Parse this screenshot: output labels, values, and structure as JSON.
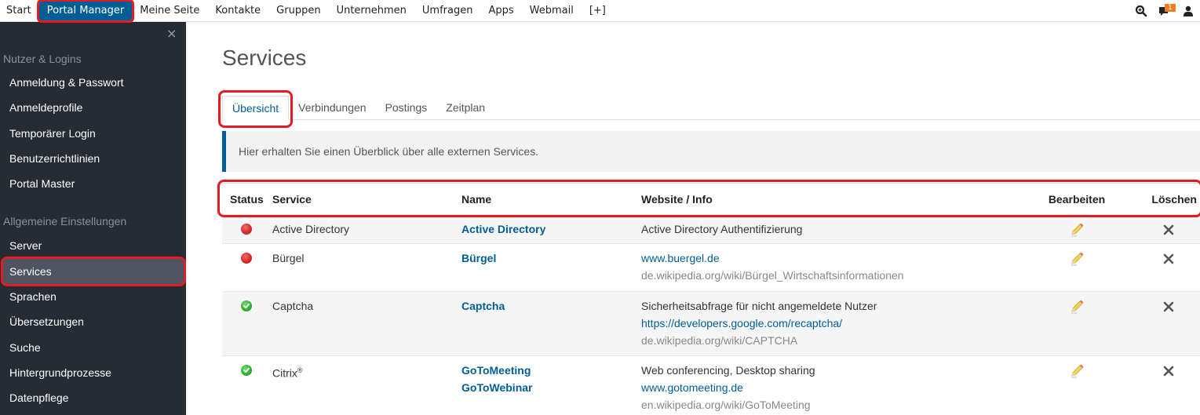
{
  "topnav": {
    "items": [
      {
        "label": "Start",
        "active": false
      },
      {
        "label": "Portal Manager",
        "active": true
      },
      {
        "label": "Meine Seite",
        "active": false
      },
      {
        "label": "Kontakte",
        "active": false
      },
      {
        "label": "Gruppen",
        "active": false
      },
      {
        "label": "Unternehmen",
        "active": false
      },
      {
        "label": "Umfragen",
        "active": false
      },
      {
        "label": "Apps",
        "active": false
      },
      {
        "label": "Webmail",
        "active": false
      },
      {
        "label": "[+]",
        "active": false
      }
    ],
    "icons": [
      "search-icon",
      "messages-icon",
      "user-icon"
    ],
    "messages_badge": "1"
  },
  "sidebar": {
    "close_icon": "×",
    "sections": [
      {
        "title": "Nutzer & Logins",
        "items": [
          "Anmeldung & Passwort",
          "Anmeldeprofile",
          "Temporärer Login",
          "Benutzerrichtlinien",
          "Portal Master"
        ]
      },
      {
        "title": "Allgemeine Einstellungen",
        "items": [
          "Server",
          "Services",
          "Sprachen",
          "Übersetzungen",
          "Suche",
          "Hintergrundprozesse",
          "Datenpflege"
        ]
      }
    ],
    "active_item": "Services"
  },
  "main": {
    "title": "Services",
    "tabs": [
      {
        "label": "Übersicht",
        "active": true
      },
      {
        "label": "Verbindungen",
        "active": false
      },
      {
        "label": "Postings",
        "active": false
      },
      {
        "label": "Zeitplan",
        "active": false
      }
    ],
    "info": "Hier erhalten Sie einen Überblick über alle externen Services.",
    "table": {
      "headers": {
        "status": "Status",
        "service": "Service",
        "name": "Name",
        "info": "Website / Info",
        "edit": "Bearbeiten",
        "delete": "Löschen"
      },
      "rows": [
        {
          "status": "inactive",
          "service": "Active Directory",
          "service_sup": "",
          "names": [
            "Active Directory"
          ],
          "description": "Active Directory Authentifizierung",
          "link": "",
          "wiki": ""
        },
        {
          "status": "inactive",
          "service": "Bürgel",
          "service_sup": "",
          "names": [
            "Bürgel"
          ],
          "description": "",
          "link": "www.buergel.de",
          "wiki": "de.wikipedia.org/wiki/Bürgel_Wirtschaftsinformationen"
        },
        {
          "status": "active",
          "service": "Captcha",
          "service_sup": "",
          "names": [
            "Captcha"
          ],
          "description": "Sicherheitsabfrage für nicht angemeldete Nutzer",
          "link": "https://developers.google.com/recaptcha/",
          "wiki": "de.wikipedia.org/wiki/CAPTCHA"
        },
        {
          "status": "active",
          "service": "Citrix",
          "service_sup": "®",
          "names": [
            "GoToMeeting",
            "GoToWebinar"
          ],
          "description": "Web conferencing, Desktop sharing",
          "link": "www.gotomeeting.de",
          "wiki": "en.wikipedia.org/wiki/GoToMeeting"
        }
      ]
    }
  },
  "colors": {
    "accent": "#005e96",
    "sidebar_bg": "#262b34",
    "sidebar_active": "#4f5460",
    "highlight": "#e31b23",
    "status_active": "#2fae2f",
    "status_inactive": "#d42a2a",
    "badge": "#f47b20"
  }
}
